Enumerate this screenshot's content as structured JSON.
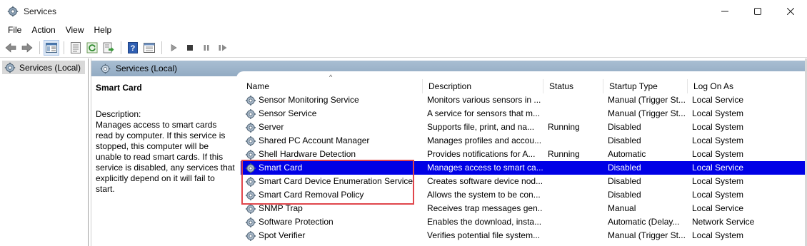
{
  "window": {
    "title": "Services",
    "icons": {
      "app": "gear-icon",
      "minimize": "minimize-icon",
      "maximize": "maximize-icon",
      "close": "close-icon"
    }
  },
  "menu": [
    "File",
    "Action",
    "View",
    "Help"
  ],
  "toolbar": {
    "buttons": [
      "back-arrow-icon",
      "forward-arrow-icon",
      "show-tree-icon",
      "properties-icon",
      "refresh-icon",
      "export-list-icon",
      "help-icon",
      "console-view-icon",
      "start-service-icon",
      "stop-service-icon",
      "pause-service-icon",
      "restart-service-icon"
    ]
  },
  "tree": {
    "root_label": "Services (Local)",
    "root_icon": "gear-icon"
  },
  "header": {
    "title": "Services (Local)"
  },
  "details": {
    "name": "Smart Card",
    "description_label": "Description:",
    "description": "Manages access to smart cards read by computer. If this service is stopped, this computer will be unable to read smart cards. If this service is disabled, any services that explicitly depend on it will fail to start."
  },
  "list": {
    "columns": [
      "Name",
      "Description",
      "Status",
      "Startup Type",
      "Log On As"
    ],
    "sort_indicator": "^",
    "rows": [
      {
        "name": "Sensor Monitoring Service",
        "description": "Monitors various sensors in ...",
        "status": "",
        "startup": "Manual (Trigger St...",
        "logon": "Local Service"
      },
      {
        "name": "Sensor Service",
        "description": "A service for sensors that m...",
        "status": "",
        "startup": "Manual (Trigger St...",
        "logon": "Local System"
      },
      {
        "name": "Server",
        "description": "Supports file, print, and na...",
        "status": "Running",
        "startup": "Disabled",
        "logon": "Local System"
      },
      {
        "name": "Shared PC Account Manager",
        "description": "Manages profiles and accou...",
        "status": "",
        "startup": "Disabled",
        "logon": "Local System"
      },
      {
        "name": "Shell Hardware Detection",
        "description": "Provides notifications for A...",
        "status": "Running",
        "startup": "Automatic",
        "logon": "Local System"
      },
      {
        "name": "Smart Card",
        "description": "Manages access to smart ca...",
        "status": "",
        "startup": "Disabled",
        "logon": "Local Service",
        "selected": true
      },
      {
        "name": "Smart Card Device Enumeration Service",
        "description": "Creates software device nod...",
        "status": "",
        "startup": "Disabled",
        "logon": "Local System"
      },
      {
        "name": "Smart Card Removal Policy",
        "description": "Allows the system to be con...",
        "status": "",
        "startup": "Disabled",
        "logon": "Local System"
      },
      {
        "name": "SNMP Trap",
        "description": "Receives trap messages gen...",
        "status": "",
        "startup": "Manual",
        "logon": "Local Service"
      },
      {
        "name": "Software Protection",
        "description": "Enables the download, insta...",
        "status": "",
        "startup": "Automatic (Delay...",
        "logon": "Network Service"
      },
      {
        "name": "Spot Verifier",
        "description": "Verifies potential file system...",
        "status": "",
        "startup": "Manual (Trigger St...",
        "logon": "Local System"
      }
    ]
  },
  "colors": {
    "selection": "#0000e6",
    "highlight_box": "#e0464b",
    "header_band": "#a9bed2"
  }
}
